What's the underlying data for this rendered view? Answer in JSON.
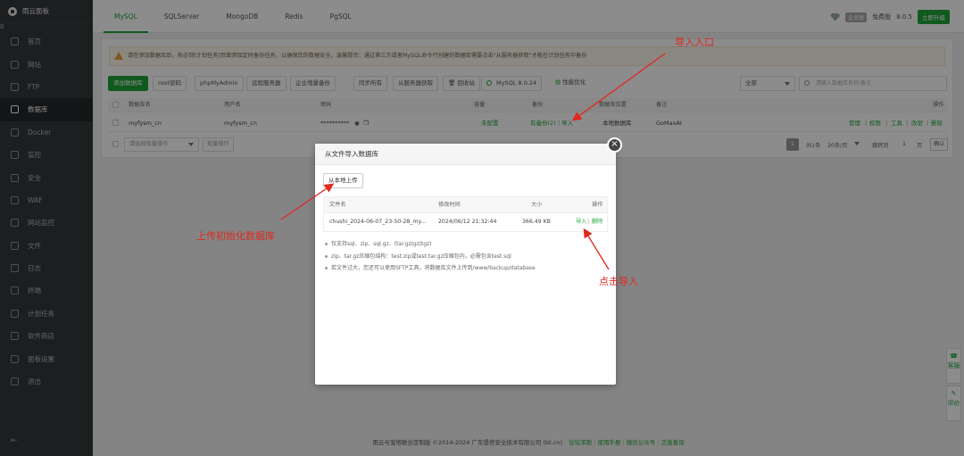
{
  "brand": {
    "name": "雨云面板",
    "badge": "0"
  },
  "nav": [
    {
      "label": "首页",
      "icon": "home-icon"
    },
    {
      "label": "网站",
      "icon": "globe-icon"
    },
    {
      "label": "FTP",
      "icon": "ftp-icon"
    },
    {
      "label": "数据库",
      "icon": "database-icon",
      "active": true
    },
    {
      "label": "Docker",
      "icon": "docker-icon"
    },
    {
      "label": "监控",
      "icon": "monitor-icon"
    },
    {
      "label": "安全",
      "icon": "shield-icon"
    },
    {
      "label": "WAF",
      "icon": "waf-icon"
    },
    {
      "label": "网站监控",
      "icon": "site-monitor-icon"
    },
    {
      "label": "文件",
      "icon": "folder-icon"
    },
    {
      "label": "日志",
      "icon": "log-icon"
    },
    {
      "label": "终端",
      "icon": "terminal-icon"
    },
    {
      "label": "计划任务",
      "icon": "clock-icon"
    },
    {
      "label": "软件商店",
      "icon": "store-icon"
    },
    {
      "label": "面板设置",
      "icon": "settings-icon"
    },
    {
      "label": "退出",
      "icon": "logout-icon"
    }
  ],
  "collapse_icon": "collapse-icon",
  "tabs": [
    "MySQL",
    "SQLServer",
    "MongoDB",
    "Redis",
    "PgSQL"
  ],
  "version": {
    "badge": "企业版",
    "label": "免费版",
    "number": "8.0.5",
    "button": "立即升级"
  },
  "notice": "请在添加数据库后，务必到[计划任务]页面添加定时备份任务，以确保您的数据安全。温馨提示：通过第三方或者MySQL命令行创建的数据库需要点击\"从服务器获取\"才能在计划任务中备份",
  "toolbar": {
    "add": "添加数据库",
    "root": "root密码",
    "phpmyadmin": "phpMyAdmin",
    "remote": "远程服务器",
    "enterprise": "企业增量备份",
    "sync_all": "同步所有",
    "fetch": "从服务器获取",
    "recycle": "回收站",
    "mysql_version": "MySQL 8.0.24",
    "perf": "性能优化",
    "filter": "全部",
    "search_placeholder": "请输入数据库名称/备注"
  },
  "table": {
    "headers": [
      "数据库名",
      "用户名",
      "密码",
      "容量",
      "备份",
      "数据库位置",
      "备注",
      "操作"
    ],
    "rows": [
      {
        "name": "myfysm_cn",
        "user": "myfysm_cn",
        "password": "**********",
        "capacity": "未配置",
        "backup": "有备份(2)",
        "import": "导入",
        "location": "本地数据库",
        "note": "GoMaxAI",
        "ops": [
          "管理",
          "权限",
          "工具",
          "改密",
          "删除"
        ]
      }
    ]
  },
  "footer_bar": {
    "batch": "请选择批量操作",
    "batch_btn": "批量操作",
    "page": "1",
    "total": "共1条",
    "per_page": "20条/页",
    "goto": "跳转到",
    "goto_page": "1",
    "page_unit": "页",
    "confirm": "确认"
  },
  "dialog": {
    "title": "从文件导入数据库",
    "upload": "从本地上传",
    "headers": [
      "文件名",
      "修改时间",
      "大小",
      "操作"
    ],
    "rows": [
      {
        "name": "chushi_2024-06-07_23-50-28_my...",
        "time": "2024/06/12 21:32:44",
        "size": "366.49 KB",
        "import": "导入",
        "delete": "删除"
      }
    ],
    "tips": [
      "仅支持sql、zip、sql.gz、(tar.gz|gz|tgz)",
      "zip、tar.gz压缩包结构：test.zip或test.tar.gz压缩包内，必需包含test.sql",
      "若文件过大，您还可以使用SFTP工具，将数据库文件上传到/www/backup/database"
    ]
  },
  "annotations": {
    "entry": "导入入口",
    "upload": "上传初始化数据库",
    "click": "点击导入"
  },
  "page_footer": "雨云与宝塔联合定制版 ©2014-2024 广东堡塔安全技术有限公司 (bt.cn)",
  "page_footer_links": [
    "论坛求助",
    "使用手册",
    "微信公众号",
    "正版查询"
  ],
  "float": {
    "service": "客服",
    "review": "评价"
  }
}
